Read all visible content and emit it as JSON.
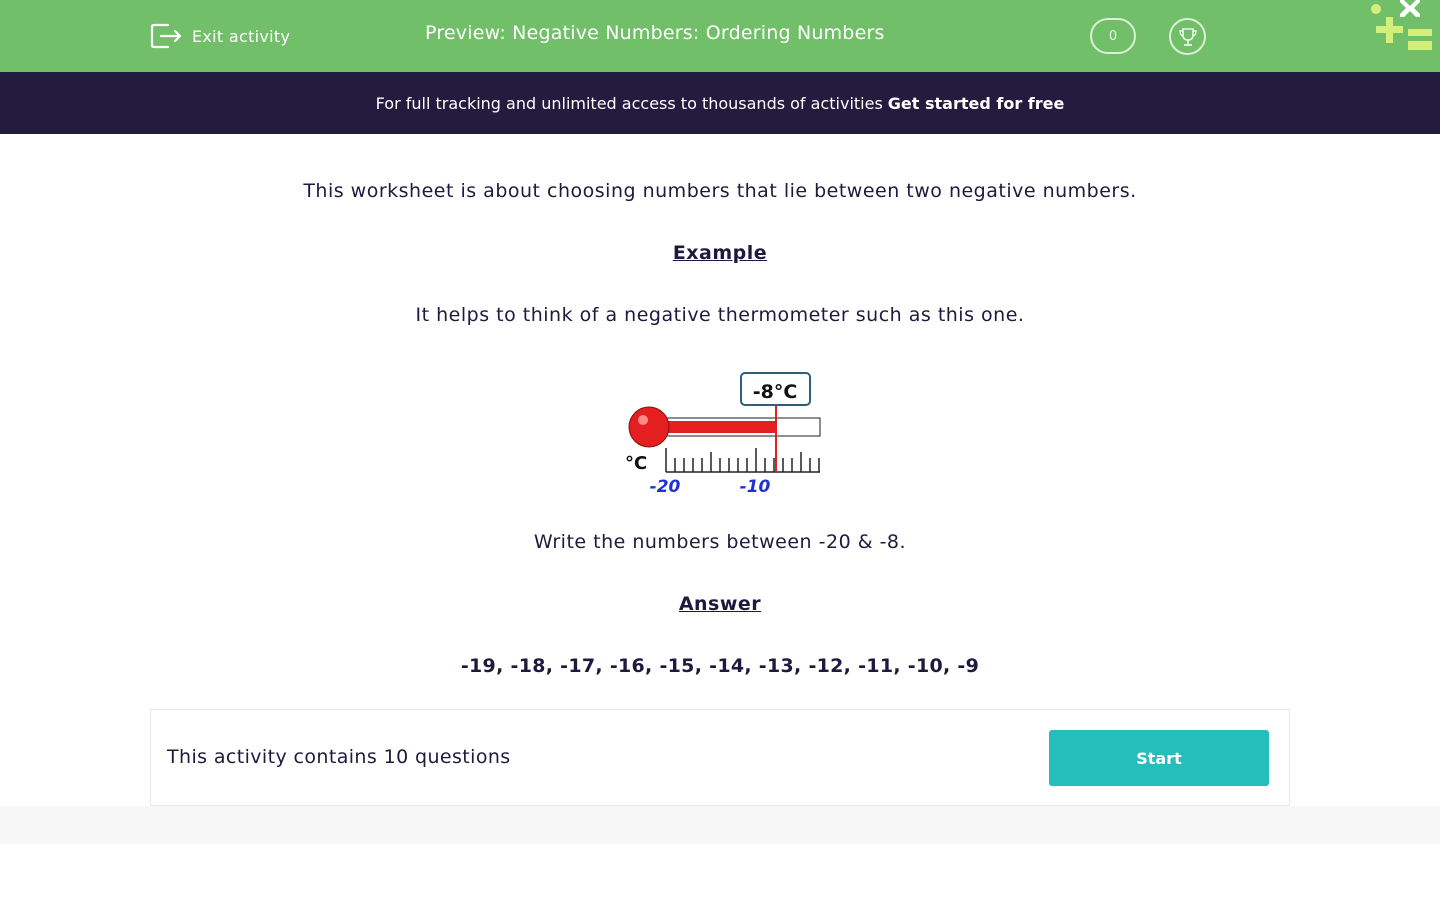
{
  "header": {
    "exit_label": "Exit activity",
    "title": "Preview: Negative Numbers: Ordering Numbers",
    "score": "0",
    "bg_color": "#72bf6a"
  },
  "promo": {
    "text": "For full tracking and unlimited access to thousands of activities",
    "link": "Get started for free",
    "bg_color": "#241c3f"
  },
  "content": {
    "intro": "This worksheet is about choosing numbers that lie between two negative numbers.",
    "example_heading": "Example",
    "example_text": "It helps to think of a negative thermometer such as this one.",
    "thermometer": {
      "reading_label": "-8°C",
      "unit_label": "°C",
      "tick_labels": [
        "-20",
        "-10"
      ],
      "reading_value": -8
    },
    "question": "Write the numbers between -20 & -8.",
    "answer_heading": "Answer",
    "answer": "-19, -18, -17, -16, -15, -14, -13, -12, -11, -10, -9"
  },
  "footer_panel": {
    "text": "This activity contains 10 questions",
    "start_label": "Start",
    "button_color": "#26bdbd"
  }
}
